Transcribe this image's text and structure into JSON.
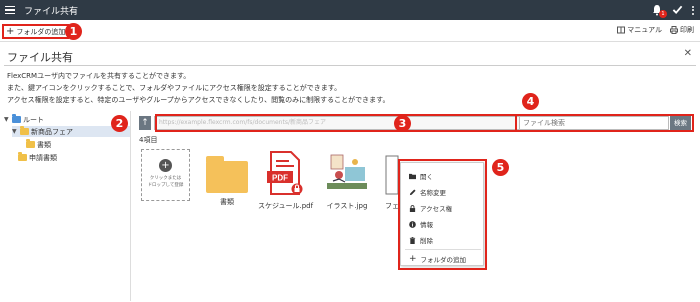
{
  "app": {
    "title": "ファイル共有",
    "notification_count": "1"
  },
  "toolbar": {
    "add_folder": "フォルダの追加",
    "manual": "マニュアル",
    "print": "印刷"
  },
  "panel": {
    "title": "ファイル共有",
    "description": [
      "FlexCRMユーザ内でファイルを共有することができます。",
      "また、鍵アイコンをクリックすることで、フォルダやファイルにアクセス権限を設定することができます。",
      "アクセス権限を設定すると、特定のユーザやグループからアクセスできなくしたり、閲覧のみに制限することができます。"
    ]
  },
  "tree": [
    {
      "label": "ルート",
      "level": 0,
      "selected": false
    },
    {
      "label": "新商品フェア",
      "level": 1,
      "selected": true
    },
    {
      "label": "書類",
      "level": 2,
      "selected": false
    },
    {
      "label": "申請書類",
      "level": 1,
      "selected": false
    }
  ],
  "main": {
    "path": "https://example.flexcrm.com/fs/documents/新商品フェア",
    "search_placeholder": "ファイル検索",
    "search_button": "検索",
    "count": "4項目",
    "dropzone": [
      "クリックまたは",
      "ドロップして登録"
    ]
  },
  "files": [
    {
      "name": "書類",
      "type": "folder"
    },
    {
      "name": "スケジュール.pdf",
      "type": "pdf"
    },
    {
      "name": "イラスト.jpg",
      "type": "image"
    },
    {
      "name": "フェ",
      "type": "doc"
    }
  ],
  "context_menu": [
    "開く",
    "名称変更",
    "アクセス権",
    "情報",
    "削除",
    "フォルダの追加"
  ],
  "markers": [
    "1",
    "2",
    "3",
    "4",
    "5"
  ],
  "colors": {
    "header": "#2f3a45",
    "marker": "#e0241b",
    "folder": "#f5c15a",
    "pdf": "#d9302c"
  }
}
